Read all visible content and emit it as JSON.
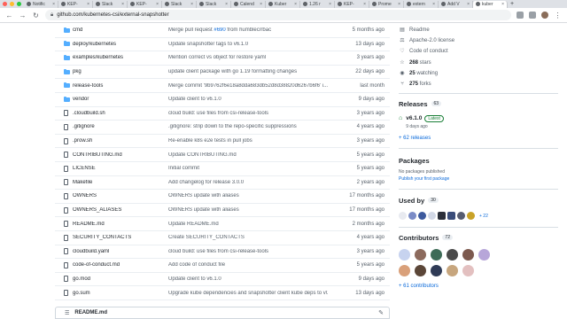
{
  "browser": {
    "tabs": [
      {
        "label": "Notific",
        "active": false
      },
      {
        "label": "KEP-",
        "active": false
      },
      {
        "label": "Slack",
        "active": false
      },
      {
        "label": "KEP-",
        "active": false
      },
      {
        "label": "Slack",
        "active": false
      },
      {
        "label": "Slack",
        "active": false
      },
      {
        "label": "Calend",
        "active": false
      },
      {
        "label": "Kuber",
        "active": false
      },
      {
        "label": "1.26 r",
        "active": false
      },
      {
        "label": "KEP-",
        "active": false
      },
      {
        "label": "Prome",
        "active": false
      },
      {
        "label": "extern",
        "active": false
      },
      {
        "label": "Add V",
        "active": false
      },
      {
        "label": "kuber",
        "active": true
      }
    ],
    "new_tab": "+",
    "url": "github.com/kubernetes-csi/external-snapshotter"
  },
  "files": [
    {
      "type": "dir",
      "name": "cmd",
      "message": "Merge pull request ",
      "link": "#690",
      "message_tail": " from humblec/rbac",
      "age": "5 months ago"
    },
    {
      "type": "dir",
      "name": "deploy/kubernetes",
      "message": "Update snapshotter tags to v6.1.0",
      "link": "",
      "message_tail": "",
      "age": "13 days ago"
    },
    {
      "type": "dir",
      "name": "examples/kubernetes",
      "message": "Mention correct vs object for restore yaml",
      "link": "",
      "message_tail": "",
      "age": "3 years ago"
    },
    {
      "type": "dir",
      "name": "pkg",
      "message": "update client package with go 1.19 formatting changes",
      "link": "",
      "message_tail": "",
      "age": "22 days ago"
    },
    {
      "type": "dir",
      "name": "release-tools",
      "message": "Merge commit '9b9762f6e18a8dda683db52d8d38820d6267b6f6' i...",
      "link": "",
      "message_tail": "",
      "age": "last month"
    },
    {
      "type": "dir",
      "name": "vendor",
      "message": "Update client to v6.1.0",
      "link": "",
      "message_tail": "",
      "age": "9 days ago"
    },
    {
      "type": "file",
      "name": ".cloudbuild.sh",
      "message": "cloud build: use files from csi-release-tools",
      "link": "",
      "message_tail": "",
      "age": "3 years ago"
    },
    {
      "type": "file",
      "name": ".gitignore",
      "message": ".gitignore: strip down to the repo-specific suppressions",
      "link": "",
      "message_tail": "",
      "age": "4 years ago"
    },
    {
      "type": "file",
      "name": ".prow.sh",
      "message": "Re-enable k8s e2e tests in pull jobs",
      "link": "",
      "message_tail": "",
      "age": "3 years ago"
    },
    {
      "type": "file",
      "name": "CONTRIBUTING.md",
      "message": "Update CONTRIBUTING.md",
      "link": "",
      "message_tail": "",
      "age": "5 years ago"
    },
    {
      "type": "file",
      "name": "LICENSE",
      "message": "Initial commit",
      "link": "",
      "message_tail": "",
      "age": "5 years ago"
    },
    {
      "type": "file",
      "name": "Makefile",
      "message": "Add changelog for release 3.0.0",
      "link": "",
      "message_tail": "",
      "age": "2 years ago"
    },
    {
      "type": "file",
      "name": "OWNERS",
      "message": "OWNERS update with aliases",
      "link": "",
      "message_tail": "",
      "age": "17 months ago"
    },
    {
      "type": "file",
      "name": "OWNERS_ALIASES",
      "message": "OWNERS update with aliases",
      "link": "",
      "message_tail": "",
      "age": "17 months ago"
    },
    {
      "type": "file",
      "name": "README.md",
      "message": "Update README.md",
      "link": "",
      "message_tail": "",
      "age": "2 months ago"
    },
    {
      "type": "file",
      "name": "SECURITY_CONTACTS",
      "message": "Create SECURITY_CONTACTS",
      "link": "",
      "message_tail": "",
      "age": "4 years ago"
    },
    {
      "type": "file",
      "name": "cloudbuild.yaml",
      "message": "cloud build: use files from csi-release-tools",
      "link": "",
      "message_tail": "",
      "age": "3 years ago"
    },
    {
      "type": "file",
      "name": "code-of-conduct.md",
      "message": "Add code of conduct file",
      "link": "",
      "message_tail": "",
      "age": "5 years ago"
    },
    {
      "type": "file",
      "name": "go.mod",
      "message": "Update client to v6.1.0",
      "link": "",
      "message_tail": "",
      "age": "9 days ago"
    },
    {
      "type": "file",
      "name": "go.sum",
      "message": "Upgrade kube dependencies and snapshotter client kube deps to v0....",
      "link": "",
      "message_tail": "",
      "age": "13 days ago"
    }
  ],
  "readme_bar": {
    "label": "README.md"
  },
  "sidebar": {
    "about": [
      {
        "icon": "book-icon",
        "text": "Readme",
        "bold": ""
      },
      {
        "icon": "law-icon",
        "text": "Apache-2.0 license",
        "bold": ""
      },
      {
        "icon": "heart-icon",
        "text": "Code of conduct",
        "bold": ""
      },
      {
        "icon": "star-icon",
        "text": " stars",
        "bold": "268"
      },
      {
        "icon": "eye-icon",
        "text": " watching",
        "bold": "25"
      },
      {
        "icon": "fork-icon",
        "text": " forks",
        "bold": "275"
      }
    ],
    "releases": {
      "title": "Releases",
      "count": "63",
      "latest_name": "v6.1.0",
      "latest_badge": "Latest",
      "latest_date": "9 days ago",
      "more": "+ 62 releases"
    },
    "packages": {
      "title": "Packages",
      "empty": "No packages published",
      "publish": "Publish your first package"
    },
    "used_by": {
      "title": "Used by",
      "count": "30",
      "more": "+ 22"
    },
    "contributors": {
      "title": "Contributors",
      "count": "72",
      "more": "+ 61 contributors"
    },
    "colors": {
      "accent": "#0969da",
      "green": "#1a7f37"
    }
  }
}
